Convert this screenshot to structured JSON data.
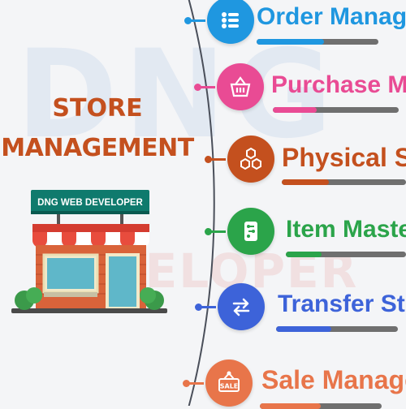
{
  "watermark": {
    "top": "DNG",
    "bottom": "DEVELOPER"
  },
  "title": {
    "line1": "STORE",
    "line2": "MANAGEMENT"
  },
  "store": {
    "sign": "DNG WEB DEVELOPER"
  },
  "menu": [
    {
      "label": "Order Manage",
      "icon": "list-icon",
      "color": "#1f97e0",
      "progress": 0.55
    },
    {
      "label": "Purchase M",
      "icon": "basket-icon",
      "color": "#e94b94",
      "progress": 0.35
    },
    {
      "label": "Physical St",
      "icon": "hexagons-icon",
      "color": "#c4501e",
      "progress": 0.38
    },
    {
      "label": "Item Maste",
      "icon": "item-master-icon",
      "color": "#2ba44a",
      "progress": 0.3
    },
    {
      "label": "Transfer St",
      "icon": "transfer-arrows-icon",
      "color": "#3d63d9",
      "progress": 0.45
    },
    {
      "label": "Sale Manage",
      "icon": "sale-tag-icon",
      "color": "#e8754a",
      "progress": 0.5
    }
  ]
}
